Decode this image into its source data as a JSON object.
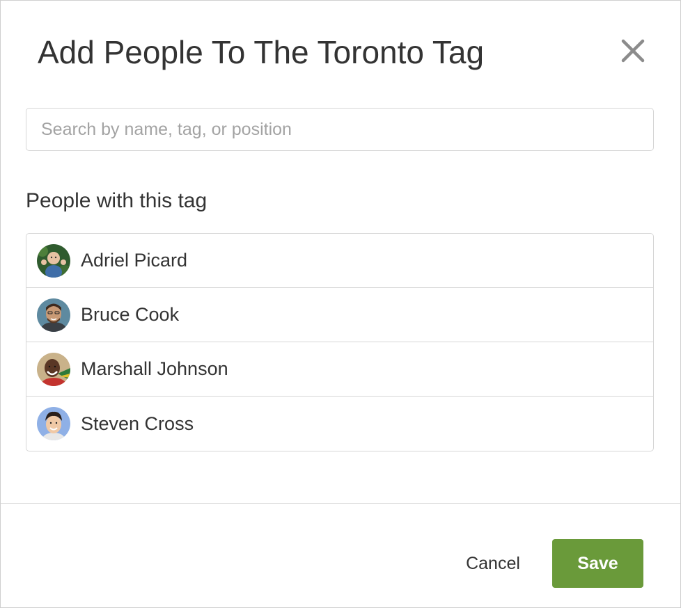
{
  "dialog": {
    "title": "Add People To The Toronto Tag",
    "close_icon": "close-icon"
  },
  "search": {
    "placeholder": "Search by name, tag, or position",
    "value": "",
    "icon": "none"
  },
  "people_section": {
    "heading": "People with this tag",
    "people": [
      {
        "name": "Adriel Picard",
        "avatar": "avatar-photo"
      },
      {
        "name": "Bruce Cook",
        "avatar": "avatar-photo"
      },
      {
        "name": "Marshall Johnson",
        "avatar": "avatar-photo"
      },
      {
        "name": "Steven Cross",
        "avatar": "avatar-photo"
      }
    ]
  },
  "footer": {
    "cancel_label": "Cancel",
    "save_label": "Save"
  },
  "colors": {
    "save_button": "#6a9a3a",
    "text": "#333333",
    "border": "#d6d6d6",
    "placeholder": "#a3a3a3",
    "close_icon": "#8c8c8c"
  }
}
